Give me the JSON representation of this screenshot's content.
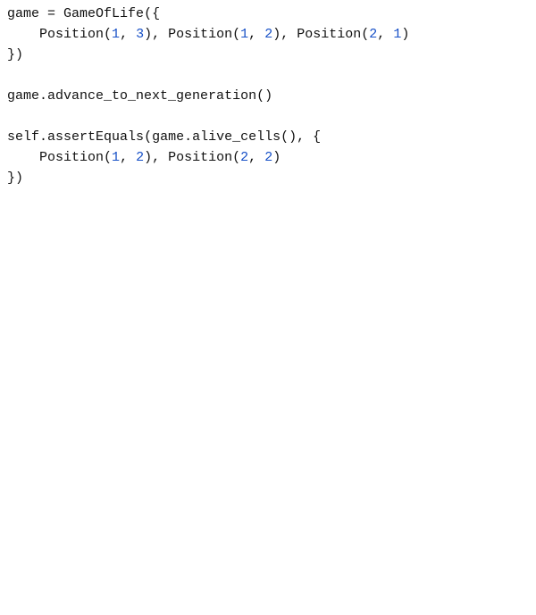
{
  "code": {
    "language": "python",
    "lines": [
      [
        {
          "t": "game ",
          "c": "tok-default"
        },
        {
          "t": "=",
          "c": "tok-punct"
        },
        {
          "t": " GameOfLife",
          "c": "tok-default"
        },
        {
          "t": "({",
          "c": "tok-punct"
        }
      ],
      [
        {
          "t": "    Position",
          "c": "tok-default"
        },
        {
          "t": "(",
          "c": "tok-punct"
        },
        {
          "t": "1",
          "c": "tok-number"
        },
        {
          "t": ",",
          "c": "tok-punct"
        },
        {
          "t": " ",
          "c": "tok-default"
        },
        {
          "t": "3",
          "c": "tok-number"
        },
        {
          "t": "),",
          "c": "tok-punct"
        },
        {
          "t": " Position",
          "c": "tok-default"
        },
        {
          "t": "(",
          "c": "tok-punct"
        },
        {
          "t": "1",
          "c": "tok-number"
        },
        {
          "t": ",",
          "c": "tok-punct"
        },
        {
          "t": " ",
          "c": "tok-default"
        },
        {
          "t": "2",
          "c": "tok-number"
        },
        {
          "t": "),",
          "c": "tok-punct"
        },
        {
          "t": " Position",
          "c": "tok-default"
        },
        {
          "t": "(",
          "c": "tok-punct"
        },
        {
          "t": "2",
          "c": "tok-number"
        },
        {
          "t": ",",
          "c": "tok-punct"
        },
        {
          "t": " ",
          "c": "tok-default"
        },
        {
          "t": "1",
          "c": "tok-number"
        },
        {
          "t": ")",
          "c": "tok-punct"
        }
      ],
      [
        {
          "t": "})",
          "c": "tok-punct"
        }
      ],
      [
        {
          "t": "",
          "c": "tok-default"
        }
      ],
      [
        {
          "t": "game",
          "c": "tok-default"
        },
        {
          "t": ".",
          "c": "tok-punct"
        },
        {
          "t": "advance_to_next_generation",
          "c": "tok-default"
        },
        {
          "t": "()",
          "c": "tok-punct"
        }
      ],
      [
        {
          "t": "",
          "c": "tok-default"
        }
      ],
      [
        {
          "t": "self",
          "c": "tok-default"
        },
        {
          "t": ".",
          "c": "tok-punct"
        },
        {
          "t": "assertEquals",
          "c": "tok-default"
        },
        {
          "t": "(",
          "c": "tok-punct"
        },
        {
          "t": "game",
          "c": "tok-default"
        },
        {
          "t": ".",
          "c": "tok-punct"
        },
        {
          "t": "alive_cells",
          "c": "tok-default"
        },
        {
          "t": "(),",
          "c": "tok-punct"
        },
        {
          "t": " ",
          "c": "tok-default"
        },
        {
          "t": "{",
          "c": "tok-punct"
        }
      ],
      [
        {
          "t": "    Position",
          "c": "tok-default"
        },
        {
          "t": "(",
          "c": "tok-punct"
        },
        {
          "t": "1",
          "c": "tok-number"
        },
        {
          "t": ",",
          "c": "tok-punct"
        },
        {
          "t": " ",
          "c": "tok-default"
        },
        {
          "t": "2",
          "c": "tok-number"
        },
        {
          "t": "),",
          "c": "tok-punct"
        },
        {
          "t": " Position",
          "c": "tok-default"
        },
        {
          "t": "(",
          "c": "tok-punct"
        },
        {
          "t": "2",
          "c": "tok-number"
        },
        {
          "t": ",",
          "c": "tok-punct"
        },
        {
          "t": " ",
          "c": "tok-default"
        },
        {
          "t": "2",
          "c": "tok-number"
        },
        {
          "t": ")",
          "c": "tok-punct"
        }
      ],
      [
        {
          "t": "})",
          "c": "tok-punct"
        }
      ]
    ]
  }
}
